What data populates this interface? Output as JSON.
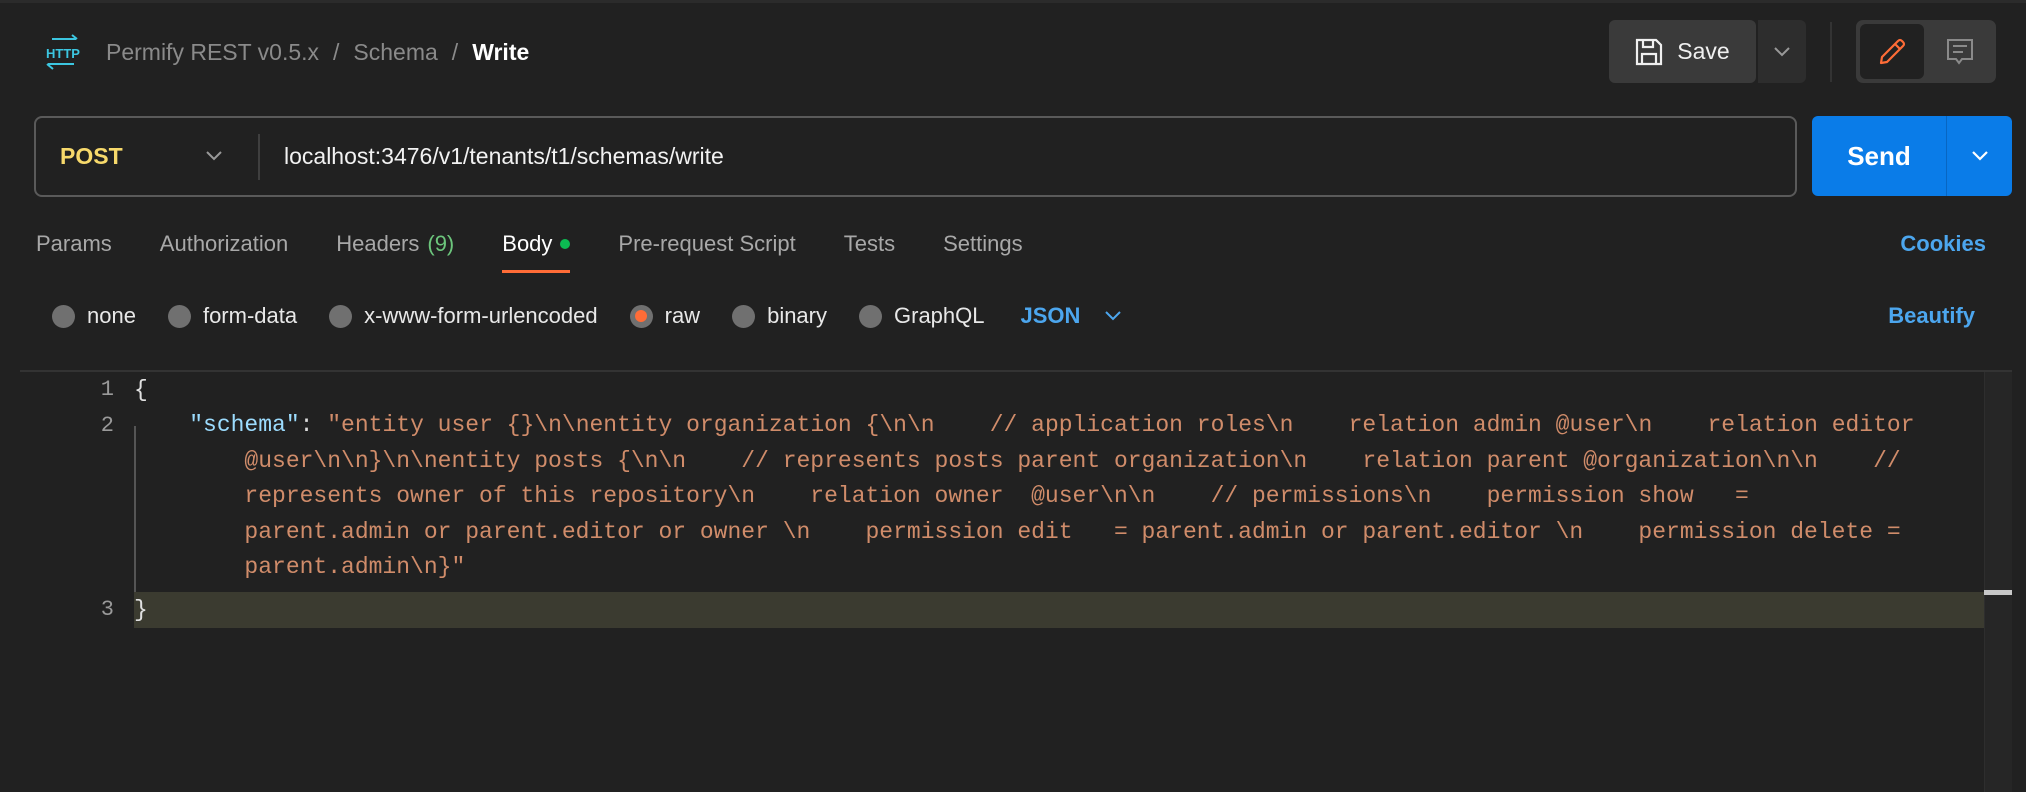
{
  "breadcrumb": {
    "collection": "Permify REST v0.5.x",
    "folder": "Schema",
    "request": "Write",
    "separator": "/",
    "icon": "http-icon"
  },
  "toolbar": {
    "save_label": "Save"
  },
  "request": {
    "method": "POST",
    "url": "localhost:3476/v1/tenants/t1/schemas/write",
    "send_label": "Send"
  },
  "tabs": [
    {
      "label": "Params"
    },
    {
      "label": "Authorization"
    },
    {
      "label": "Headers",
      "count": "(9)"
    },
    {
      "label": "Body",
      "active": true
    },
    {
      "label": "Pre-request Script"
    },
    {
      "label": "Tests"
    },
    {
      "label": "Settings"
    }
  ],
  "cookies_label": "Cookies",
  "body_types": [
    {
      "label": "none"
    },
    {
      "label": "form-data"
    },
    {
      "label": "x-www-form-urlencoded"
    },
    {
      "label": "raw",
      "selected": true
    },
    {
      "label": "binary"
    },
    {
      "label": "GraphQL"
    }
  ],
  "format": "JSON",
  "beautify_label": "Beautify",
  "editor": {
    "line_numbers": [
      "1",
      "2",
      "3"
    ],
    "open_brace": "{",
    "close_brace": "}",
    "indent": "    ",
    "key": "\"schema\"",
    "colon": ": ",
    "value": "\"entity user {}\\n\\nentity organization {\\n\\n    // application roles\\n    relation admin @user\\n    relation editor @user\\n\\n}\\n\\nentity posts {\\n\\n    // represents posts parent organization\\n    relation parent @organization\\n\\n    // represents owner of this repository\\n    relation owner  @user\\n\\n    // permissions\\n    permission show   = parent.admin or parent.editor or owner \\n    permission edit   = parent.admin or parent.editor \\n    permission delete = parent.admin\\n}\""
  },
  "colors": {
    "accent": "#ff6c37",
    "primary": "#0a7ce8",
    "method": "#f7d96b",
    "link": "#4ca6ee",
    "json_key": "#9cdcfe",
    "json_string": "#d08c6a"
  }
}
